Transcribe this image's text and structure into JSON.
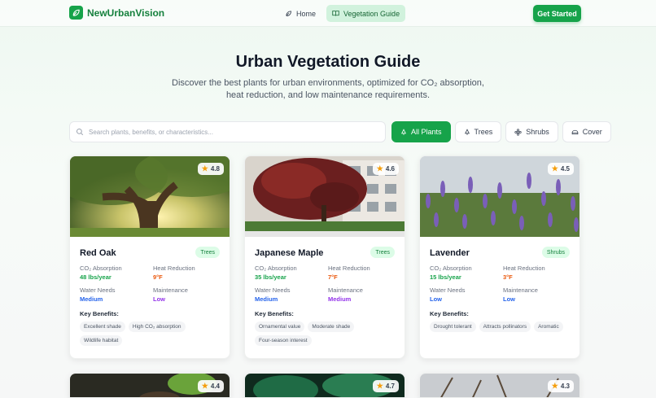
{
  "brand": {
    "name": "NewUrbanVision"
  },
  "nav": {
    "items": [
      {
        "label": "Home"
      },
      {
        "label": "Vegetation Guide"
      }
    ]
  },
  "header": {
    "cta_label": "Get Started"
  },
  "hero": {
    "title": "Urban Vegetation Guide",
    "subtitle": "Discover the best plants for urban environments, optimized for CO₂ absorption, heat reduction, and low maintenance requirements."
  },
  "search": {
    "placeholder": "Search plants, benefits, or characteristics..."
  },
  "filters": [
    {
      "label": "All Plants",
      "active": true
    },
    {
      "label": "Trees"
    },
    {
      "label": "Shrubs"
    },
    {
      "label": "Cover"
    }
  ],
  "labels": {
    "co2": "CO₂ Absorption",
    "heat": "Heat Reduction",
    "water": "Water Needs",
    "maintenance": "Maintenance",
    "key_benefits": "Key Benefits:"
  },
  "plants": [
    {
      "name": "Red Oak",
      "category": "Trees",
      "rating": "4.8",
      "co2": "48 lbs/year",
      "heat": "9°F",
      "water": "Medium",
      "maintenance": "Low",
      "benefits": [
        "Excellent shade",
        "High CO₂ absorption",
        "Wildlife habitat"
      ]
    },
    {
      "name": "Japanese Maple",
      "category": "Trees",
      "rating": "4.6",
      "co2": "35 lbs/year",
      "heat": "7°F",
      "water": "Medium",
      "maintenance": "Medium",
      "benefits": [
        "Ornamental value",
        "Moderate shade",
        "Four-season interest"
      ]
    },
    {
      "name": "Lavender",
      "category": "Shrubs",
      "rating": "4.5",
      "co2": "15 lbs/year",
      "heat": "3°F",
      "water": "Low",
      "maintenance": "Low",
      "benefits": [
        "Drought tolerant",
        "Attracts pollinators",
        "Aromatic"
      ]
    }
  ],
  "more_ratings": [
    "4.4",
    "4.7",
    "4.3"
  ],
  "colors": {
    "accent": "#16a34a",
    "heat": "#ea580c",
    "water": "#2563eb",
    "maintenance_medium": "#9333ea"
  }
}
